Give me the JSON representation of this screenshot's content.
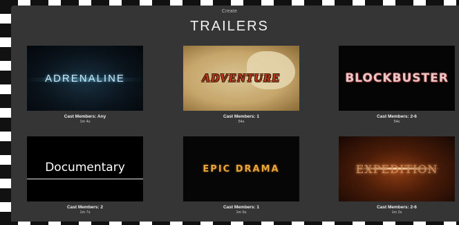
{
  "header": {
    "create_label": "Create",
    "title": "TRAILERS"
  },
  "trailers": [
    {
      "title": "Adrenaline",
      "thumb_text": "ADRENALINE",
      "cast": "Cast Members: Any",
      "duration": "1m 4s"
    },
    {
      "title": "Adventure",
      "thumb_text": "ADVENTURE",
      "cast": "Cast Members: 1",
      "duration": "54s"
    },
    {
      "title": "Blockbuster",
      "thumb_text": "BLOCKBUSTER",
      "cast": "Cast Members: 2-6",
      "duration": "54s"
    },
    {
      "title": "Documentary",
      "thumb_text": "Documentary",
      "cast": "Cast Members: 2",
      "duration": "1m 7s"
    },
    {
      "title": "Epic Drama",
      "thumb_text": "EPIC DRAMA",
      "cast": "Cast Members: 1",
      "duration": "1m 6s"
    },
    {
      "title": "Expedition",
      "thumb_text": "EXPEDITION",
      "cast": "Cast Members: 2-6",
      "duration": "1m 2s"
    }
  ],
  "colors": {
    "panel_background": "#353535",
    "title_text": "#f2f2f2",
    "epic_drama_gold": "#e9a53a",
    "adventure_red": "#c23a1c"
  }
}
